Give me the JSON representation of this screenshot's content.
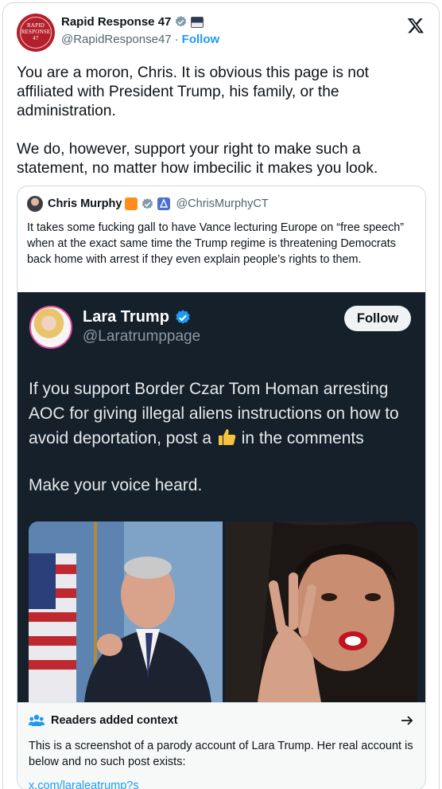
{
  "account": {
    "name": "Rapid Response 47",
    "handle": "@RapidResponse47",
    "separator": "·",
    "follow_label": "Follow",
    "avatar_text": "RAPID RESPONSE 47"
  },
  "tweet": {
    "text": "You are a moron, Chris. It is obvious this page is not affiliated with President Trump, his family, or the administration.\n\nWe do, however, support your right to make such a statement, no matter how imbecilic it makes you look."
  },
  "quote": {
    "name": "Chris Murphy",
    "handle": "@ChrisMurphyCT",
    "text": "It takes some fucking gall to have Vance lecturing Europe on “free speech” when at the exact same time the Trump regime is threatening Democrats back home with arrest if they even explain people’s rights to them."
  },
  "embedded_post": {
    "name": "Lara Trump",
    "handle": "@Laratrumppage",
    "follow_label": "Follow",
    "text_before_emoji": "If you support Border Czar Tom Homan arresting AOC for giving illegal aliens instructions on how to avoid deportation, post a",
    "text_after_emoji": "in the comments",
    "text_2": "Make your voice heard."
  },
  "context": {
    "title": "Readers added context",
    "text": "This is a screenshot of a parody account of Lara Trump. Her real account is below and no such post exists:",
    "link": "x.com/laralеatrump?s"
  },
  "colors": {
    "accent": "#1d9bf0",
    "dark_card": "#15202b",
    "text": "#0f1419",
    "muted": "#536471"
  },
  "icons": [
    "verified-badge-icon",
    "x-logo-icon",
    "people-icon",
    "arrow-right-icon",
    "thumbs-up-icon"
  ]
}
